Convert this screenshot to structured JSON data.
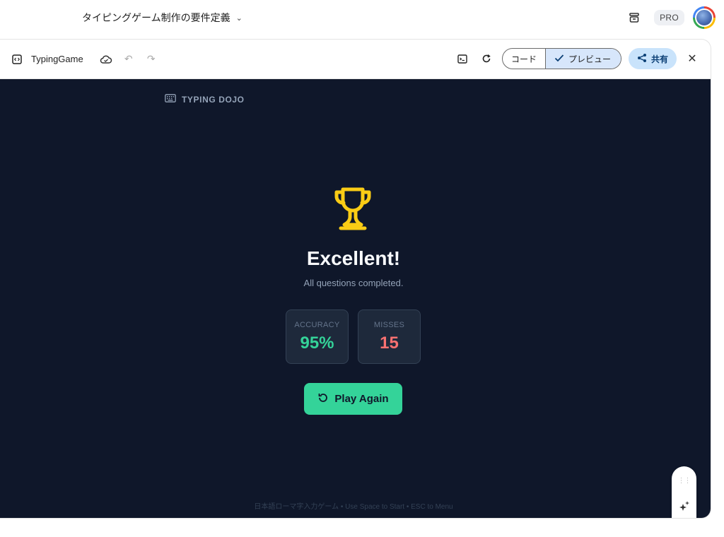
{
  "header": {
    "chat_title": "タイピングゲーム制作の要件定義",
    "pro_label": "PRO"
  },
  "toolbar": {
    "app_name": "TypingGame",
    "code_label": "コード",
    "preview_label": "プレビュー",
    "share_label": "共有"
  },
  "preview": {
    "brand": "TYPING DOJO",
    "result_title": "Excellent!",
    "result_subtitle": "All questions completed.",
    "accuracy_label": "ACCURACY",
    "accuracy_value": "95%",
    "misses_label": "MISSES",
    "misses_value": "15",
    "play_again_label": "Play Again",
    "footer": "日本語ローマ字入力ゲーム • Use Space to Start • ESC to Menu"
  },
  "colors": {
    "preview_bg": "#0f172a",
    "accent_green": "#34d399",
    "miss_red": "#f87171",
    "trophy_yellow": "#facc15"
  }
}
